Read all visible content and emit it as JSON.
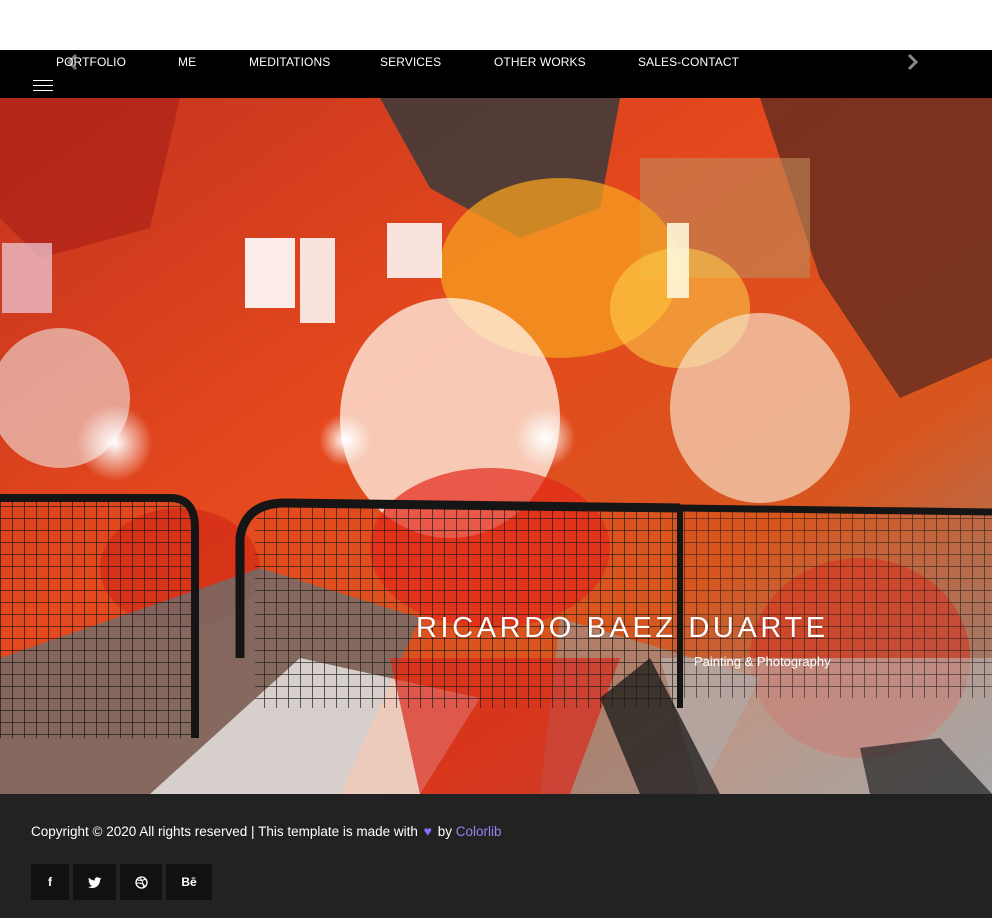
{
  "nav": {
    "items": [
      {
        "label": "PORTFOLIO"
      },
      {
        "label": "ME"
      },
      {
        "label": "MEDITATIONS"
      },
      {
        "label": "SERVICES"
      },
      {
        "label": "OTHER WORKS"
      },
      {
        "label": "SALES-CONTACT"
      }
    ],
    "prev_icon": "chevron-left-icon",
    "next_icon": "chevron-right-icon",
    "menu_icon": "hamburger-menu-icon"
  },
  "hero": {
    "title": "RICARDO BAEZ DUARTE",
    "subtitle": "Painting & Photography"
  },
  "footer": {
    "copyright_text": "Copyright © 2020 All rights reserved | This template is made with",
    "heart_glyph": "♥",
    "by_text": "by",
    "brand_link": "Colorlib",
    "social": [
      {
        "icon": "facebook-icon",
        "glyph": "f"
      },
      {
        "icon": "twitter-icon",
        "glyph": "🐦"
      },
      {
        "icon": "dribbble-icon",
        "glyph": "◎"
      },
      {
        "icon": "behance-icon",
        "glyph": "Bē"
      }
    ]
  },
  "colors": {
    "navbar": "#000000",
    "footer": "#222222",
    "social_button": "#111111",
    "heart": "#8a6bff",
    "link": "#8f86f3"
  }
}
